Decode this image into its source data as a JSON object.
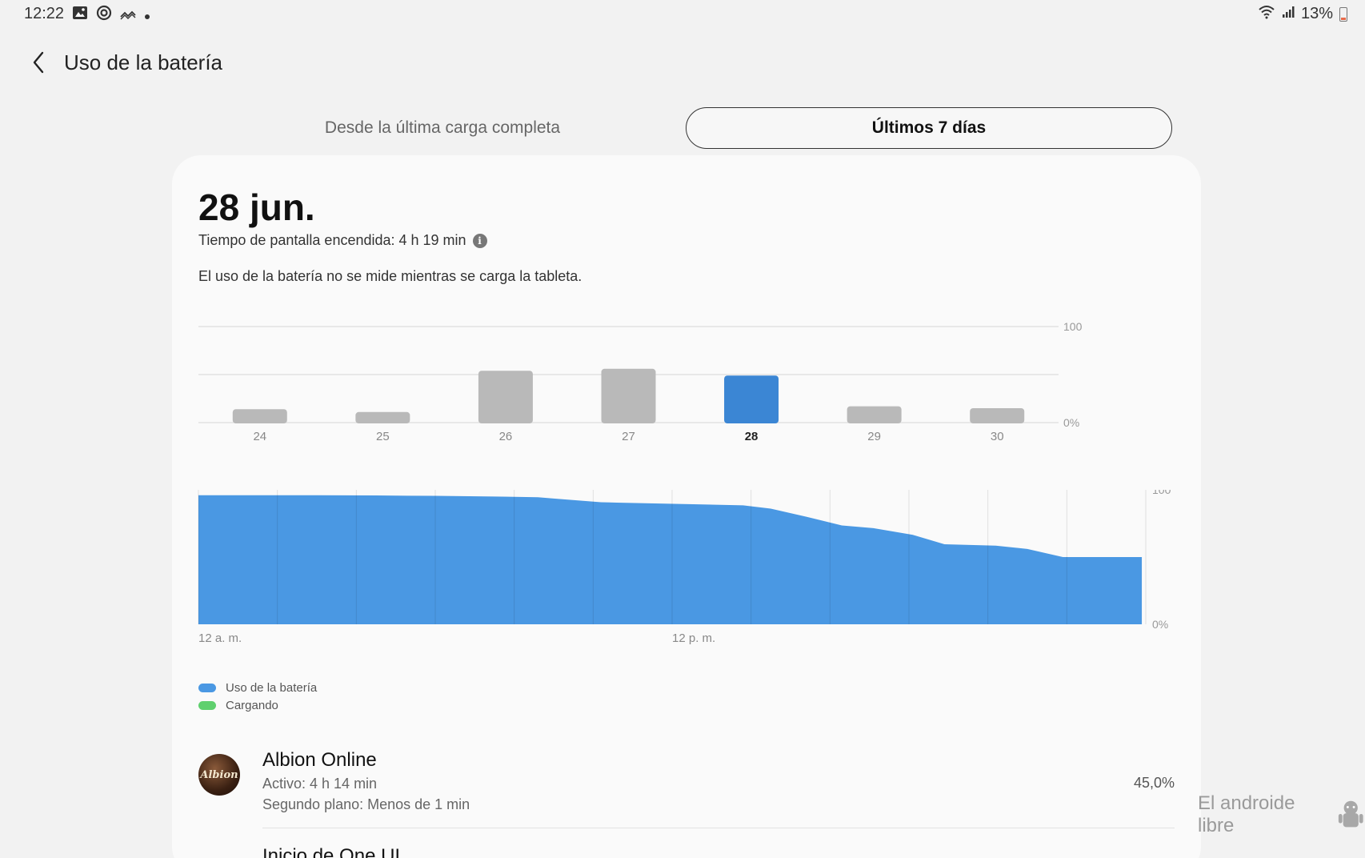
{
  "status_bar": {
    "time": "12:22",
    "left_icons": [
      "image-icon",
      "sync-icon",
      "wave-icon",
      "dot-icon"
    ],
    "battery_percent": "13%"
  },
  "header": {
    "title": "Uso de la batería"
  },
  "tabs": [
    {
      "label": "Desde la última carga completa",
      "selected": false
    },
    {
      "label": "Últimos 7 días",
      "selected": true
    }
  ],
  "card": {
    "date": "28 jun.",
    "screen_time": "Tiempo de pantalla encendida: 4 h 19 min",
    "notice": "El uso de la batería no se mide mientras se carga la tableta."
  },
  "colors": {
    "accent": "#3b86d4",
    "usage": "#4a98e3",
    "charging": "#5fd06e",
    "bar_grey": "#b9b9b9"
  },
  "chart_data": [
    {
      "type": "bar",
      "categories": [
        "24",
        "25",
        "26",
        "27",
        "28",
        "29",
        "30"
      ],
      "values": [
        14,
        11,
        54,
        56,
        49,
        17,
        15
      ],
      "selected": "28",
      "ylim": [
        0,
        100
      ],
      "ytick_labels": [
        "100",
        "0%"
      ],
      "grid": true
    },
    {
      "type": "area",
      "x": [
        0,
        1.5,
        3,
        4.5,
        6,
        7.5,
        8.6,
        9,
        10.2,
        10.6,
        13.8,
        14.5,
        15.4,
        16.3,
        17.1,
        18.1,
        18.9,
        20.2,
        21.0,
        21.9,
        23.9
      ],
      "values": [
        96,
        96,
        96,
        95.8,
        95.5,
        95,
        94.5,
        93.5,
        90.8,
        90.5,
        88.5,
        86,
        80,
        73.5,
        71.5,
        66.5,
        59.5,
        58.5,
        56,
        50,
        50
      ],
      "xtick_labels": [
        "12 a. m.",
        "12 p. m."
      ],
      "ytick_labels": [
        "100",
        "0%"
      ],
      "ylim": [
        0,
        100
      ],
      "legend": [
        {
          "label": "Uso de la batería",
          "color": "#4a98e3"
        },
        {
          "label": "Cargando",
          "color": "#5fd06e"
        }
      ]
    }
  ],
  "legend": [
    {
      "label": "Uso de la batería"
    },
    {
      "label": "Cargando"
    }
  ],
  "apps": [
    {
      "name": "Albion Online",
      "icon_text": "Albion",
      "active": "Activo: 4 h 14 min",
      "background": "Segundo plano: Menos de 1 min",
      "percent": "45,0%"
    },
    {
      "name": "Inicio de One UI"
    }
  ],
  "watermark": "El androide libre"
}
